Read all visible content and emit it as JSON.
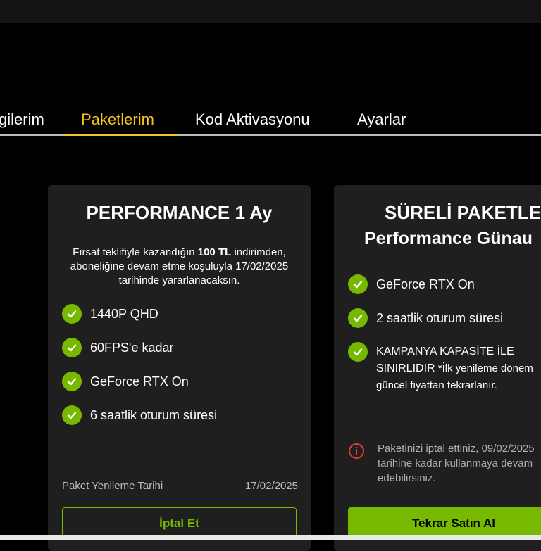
{
  "tabs": [
    {
      "label": "gilerim",
      "active": false
    },
    {
      "label": "Paketlerim",
      "active": true
    },
    {
      "label": "Kod Aktivasyonu",
      "active": false
    },
    {
      "label": "Ayarlar",
      "active": false
    }
  ],
  "colors": {
    "accent": "#f5c518",
    "nvidia_green": "#76b900",
    "card_bg": "#1f1f1f",
    "error_red": "#e53935"
  },
  "card1": {
    "title": "PERFORMANCE 1 Ay",
    "desc_prefix": "Fırsat teklifiyle kazandığın ",
    "desc_bold": "100 TL",
    "desc_suffix": " indirimden, aboneliğine devam etme koşuluyla 17/02/2025 tarihinde yararlanacaksın.",
    "features": [
      "1440P QHD",
      "60FPS'e kadar",
      "GeForce RTX On",
      "6 saatlik oturum süresi"
    ],
    "feature_icon": "check-circle-icon",
    "renew_label": "Paket Yenileme Tarihi",
    "renew_date": "17/02/2025",
    "cancel_label": "İptal Et"
  },
  "card2": {
    "title_line1": "SÜRELİ PAKETLER",
    "title_line2": "Performance Günau",
    "features": [
      "GeForce RTX On",
      "2 saatlik oturum süresi"
    ],
    "feature3_bold": "KAMPANYA KAPASİTE İLE SINIRLIDIR",
    "feature3_rest": " *İlk yenileme dönem güncel fiyattan tekrarlanır.",
    "alert_icon": "info-circle-icon",
    "alert_text": "Paketinizi iptal ettiniz, 09/02/2025 tarihine kadar kullanmaya devam edebilirsiniz.",
    "buy_label": "Tekrar Satın Al"
  }
}
